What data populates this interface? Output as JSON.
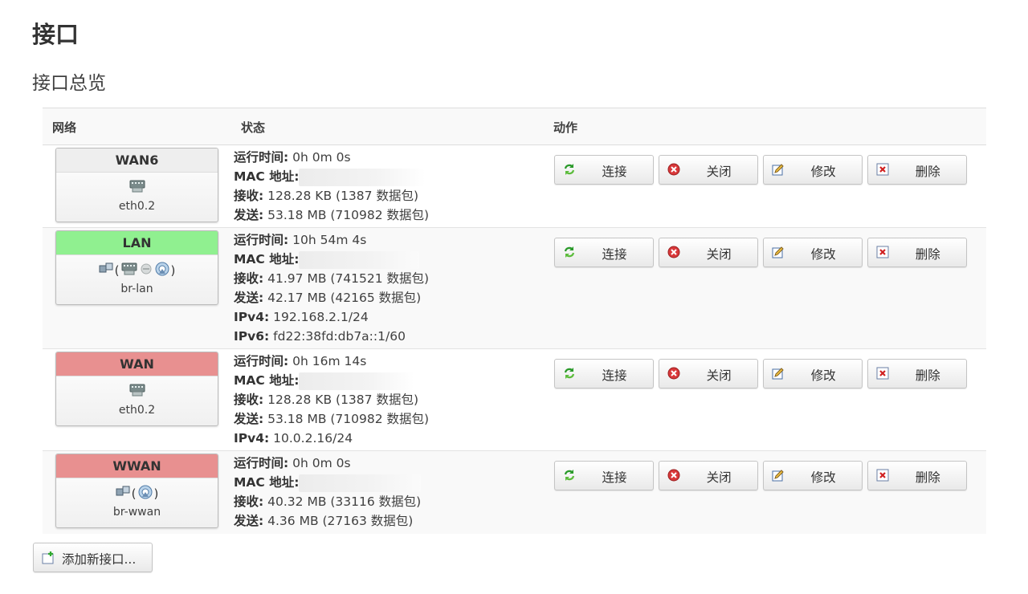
{
  "page": {
    "title": "接口",
    "section_title": "接口总览"
  },
  "table": {
    "headers": {
      "network": "网络",
      "status": "状态",
      "actions": "动作"
    },
    "status_labels": {
      "uptime": "运行时间:",
      "mac": "MAC 地址:",
      "rx": "接收:",
      "tx": "发送:",
      "ipv4": "IPv4:",
      "ipv6": "IPv6:"
    },
    "button_labels": {
      "connect": "连接",
      "stop": "关闭",
      "edit": "修改",
      "delete": "删除"
    },
    "rows": [
      {
        "name": "WAN6",
        "header_color": "#eeeeee",
        "device": "eth0.2",
        "icons": [
          "ethernet-port-icon"
        ],
        "uptime": "0h 0m 0s",
        "rx": "128.28 KB (1387 数据包)",
        "tx": "53.18 MB (710982 数据包)"
      },
      {
        "name": "LAN",
        "header_color": "#90f090",
        "device": "br-lan",
        "icons": [
          "bridge-icon",
          "ethernet-port-icon",
          "ethernet-disabled-icon",
          "wifi-icon"
        ],
        "uptime": "10h 54m 4s",
        "rx": "41.97 MB (741521 数据包)",
        "tx": "42.17 MB (42165 数据包)",
        "ipv4": "192.168.2.1/24",
        "ipv6": "fd22:38fd:db7a::1/60"
      },
      {
        "name": "WAN",
        "header_color": "#e89090",
        "device": "eth0.2",
        "icons": [
          "ethernet-port-icon"
        ],
        "uptime": "0h 16m 14s",
        "rx": "128.28 KB (1387 数据包)",
        "tx": "53.18 MB (710982 数据包)",
        "ipv4": "10.0.2.16/24"
      },
      {
        "name": "WWAN",
        "header_color": "#e89090",
        "device": "br-wwan",
        "icons": [
          "bridge-icon",
          "wifi-icon"
        ],
        "uptime": "0h 0m 0s",
        "rx": "40.32 MB (33116 数据包)",
        "tx": "4.36 MB (27163 数据包)"
      }
    ]
  },
  "footer": {
    "add_button_label": "添加新接口..."
  }
}
